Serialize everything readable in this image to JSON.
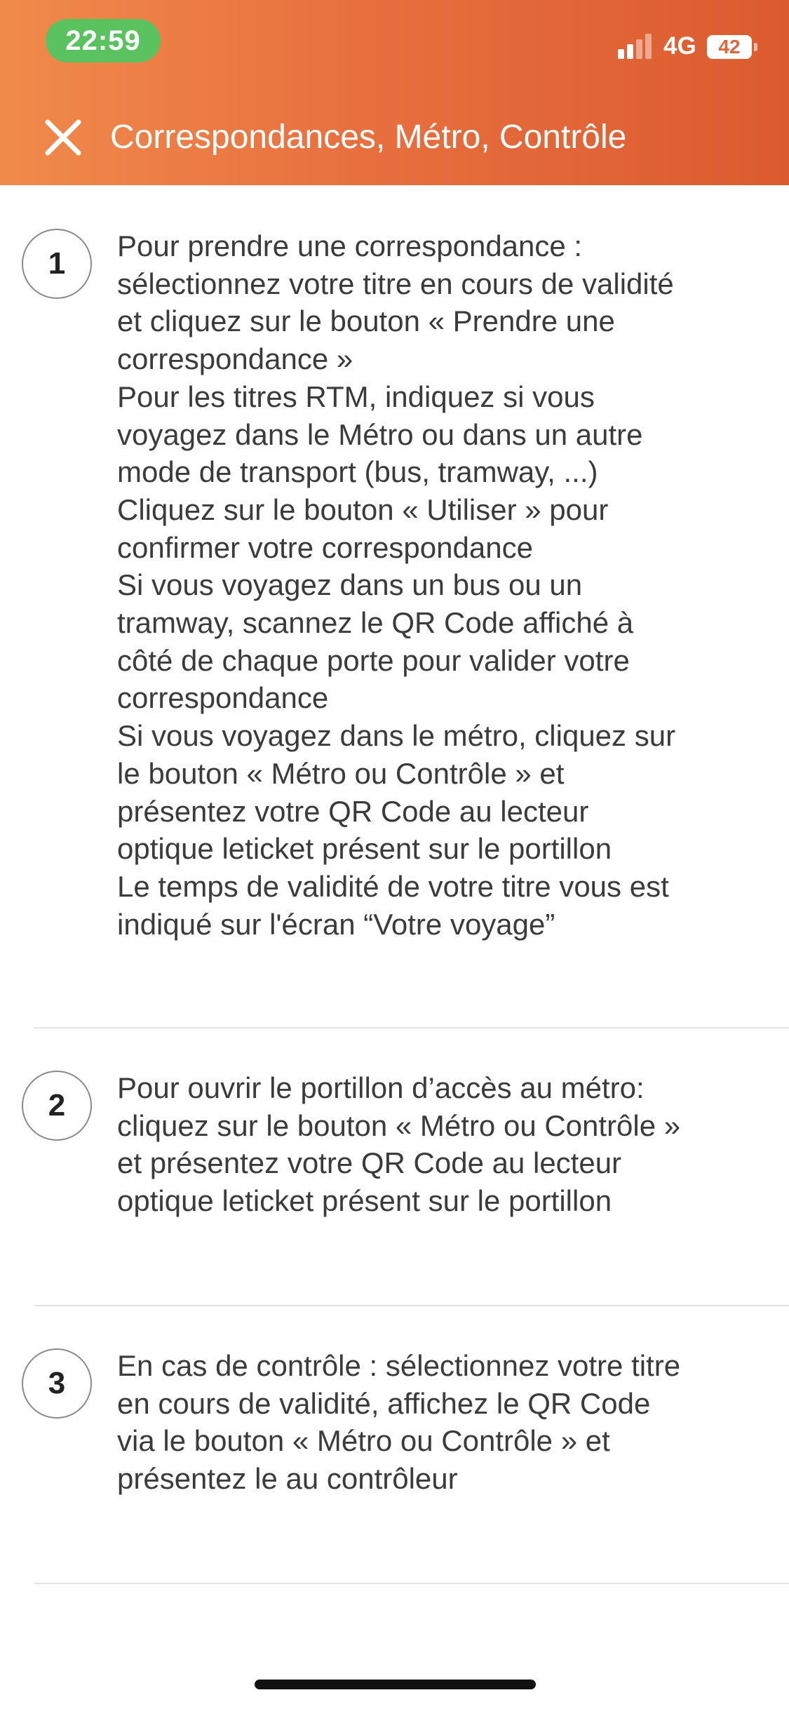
{
  "status_bar": {
    "time": "22:59",
    "network": "4G",
    "battery": "42"
  },
  "header": {
    "title": "Correspondances, Métro, Contrôle",
    "close_icon": "close-icon"
  },
  "steps": [
    {
      "number": "1",
      "lines": [
        "Pour prendre une correspondance :",
        "sélectionnez votre titre en cours de validité",
        "et cliquez sur le bouton « Prendre une",
        "correspondance »",
        "Pour les titres RTM, indiquez si vous",
        "voyagez dans le Métro ou dans un autre",
        "mode de transport (bus, tramway, ...)",
        "Cliquez sur le bouton « Utiliser » pour",
        "confirmer votre correspondance",
        "Si vous voyagez dans un bus ou un",
        "tramway, scannez le QR Code affiché à",
        "côté de chaque porte pour valider votre",
        "correspondance",
        "Si vous voyagez dans le métro, cliquez sur",
        "le bouton « Métro ou Contrôle » et",
        "présentez votre QR Code au lecteur",
        "optique leticket présent sur le portillon",
        "Le temps de validité de votre titre vous est",
        "indiqué sur l'écran “Votre voyage”"
      ]
    },
    {
      "number": "2",
      "lines": [
        "Pour ouvrir le portillon d’accès au métro:",
        "cliquez sur le bouton « Métro ou Contrôle »",
        "et présentez votre QR Code au lecteur",
        "optique leticket présent sur le portillon"
      ]
    },
    {
      "number": "3",
      "lines": [
        "En cas de contrôle : sélectionnez votre titre",
        "en cours de validité, affichez le QR Code",
        "via le bouton « Métro ou Contrôle » et",
        "présentez le au contrôleur"
      ]
    }
  ],
  "colors": {
    "header_start": "#f08a4b",
    "header_end": "#db5b2f",
    "time_pill": "#5ac35f"
  }
}
